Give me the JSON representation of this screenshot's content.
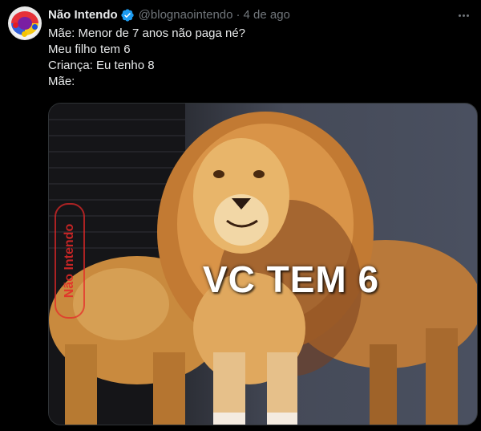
{
  "tweet": {
    "display_name": "Não Intendo",
    "handle": "@blognaointendo",
    "separator": "·",
    "time": "4 de ago",
    "text_lines": [
      "Mãe: Menor de 7 anos não paga né?",
      "Meu filho tem 6",
      "Criança: Eu tenho 8",
      "Mãe:"
    ]
  },
  "media": {
    "caption": "VC TEM 6",
    "watermark": "Não Intendo"
  },
  "icons": {
    "verified": "verified-badge-icon",
    "more": "more-options-icon"
  },
  "colors": {
    "background": "#000000",
    "primary_text": "#e7e9ea",
    "secondary_text": "#71767b",
    "verified_blue": "#1d9bf0",
    "watermark_red": "#e62828"
  }
}
